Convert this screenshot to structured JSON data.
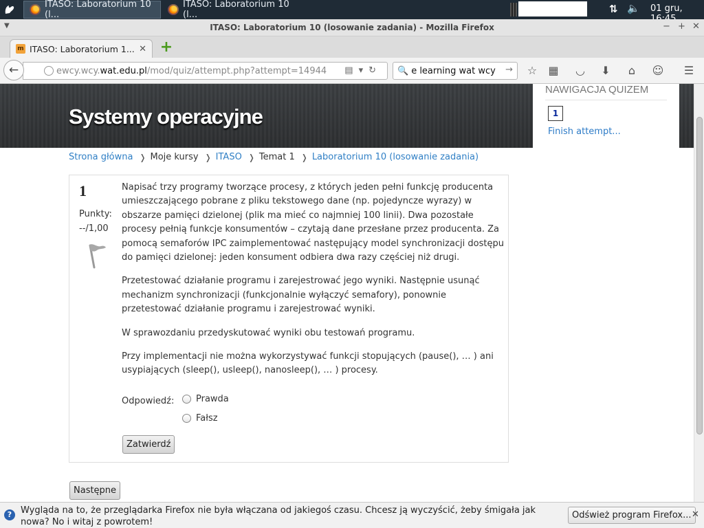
{
  "taskbar": {
    "tasks": [
      {
        "label": "ITASO: Laboratorium 10 (l..."
      },
      {
        "label": "ITASO: Laboratorium 10 (l..."
      }
    ],
    "clock": "01 gru, 16:45"
  },
  "window": {
    "title": "ITASO: Laboratorium 10 (losowanie zadania) - Mozilla Firefox"
  },
  "tab": {
    "label": "ITASO: Laboratorium 1...",
    "favicon": "m"
  },
  "navbar": {
    "url_prefix": "ewcy.wcy.",
    "url_domain": "wat.edu.pl",
    "url_path": "/mod/quiz/attempt.php?attempt=14944",
    "search_value": "e learning wat wcy"
  },
  "page": {
    "site_title": "Systemy operacyjne",
    "quiz_nav": {
      "heading": "NAWIGACJA QUIZEM",
      "question_button": "1",
      "finish_link": "Finish attempt..."
    },
    "breadcrumbs": [
      {
        "label": "Strona główna",
        "link": true
      },
      {
        "label": "Moje kursy",
        "link": false
      },
      {
        "label": "ITASO",
        "link": true
      },
      {
        "label": "Temat 1",
        "link": false
      },
      {
        "label": "Laboratorium 10 (losowanie zadania)",
        "link": true
      }
    ],
    "question": {
      "number": "1",
      "points_label": "Punkty:",
      "points_value": "--/1,00",
      "paragraphs": [
        "Napisać trzy programy tworzące procesy, z których jeden pełni funkcję producenta umieszczającego pobrane z pliku tekstowego dane (np. pojedyncze wyrazy) w obszarze pamięci dzielonej (plik ma mieć co najmniej 100 linii). Dwa pozostałe procesy pełnią funkcje konsumentów – czytają dane przesłane przez producenta. Za pomocą semaforów IPC zaimplementować następujący model synchronizacji dostępu do pamięci dzielonej: jeden konsument odbiera dwa razy częściej niż drugi.",
        "Przetestować działanie programu i zarejestrować jego wyniki. Następnie usunąć mechanizm synchronizacji (funkcjonalnie wyłączyć semafory), ponownie przetestować działanie programu i zarejestrować wyniki.",
        "W sprawozdaniu przedyskutować wyniki obu testowań programu.",
        "Przy implementacji nie można wykorzystywać funkcji stopujących (pause(), … ) ani usypiających (sleep(), usleep(), nanosleep(), … ) procesy."
      ],
      "answer_label": "Odpowiedź:",
      "options": [
        "Prawda",
        "Fałsz"
      ],
      "submit_label": "Zatwierdź"
    },
    "next_label": "Następne"
  },
  "notification": {
    "message": "Wygląda na to, że przeglądarka Firefox nie była włączana od jakiegoś czasu. Chcesz ją wyczyścić, żeby śmigała jak nowa? No i witaj z powrotem!",
    "button": "Odśwież program Firefox..."
  },
  "colors": {
    "link": "#2f7fc5",
    "header_bg": "#333537",
    "panel_bg": "#1f2b36"
  }
}
